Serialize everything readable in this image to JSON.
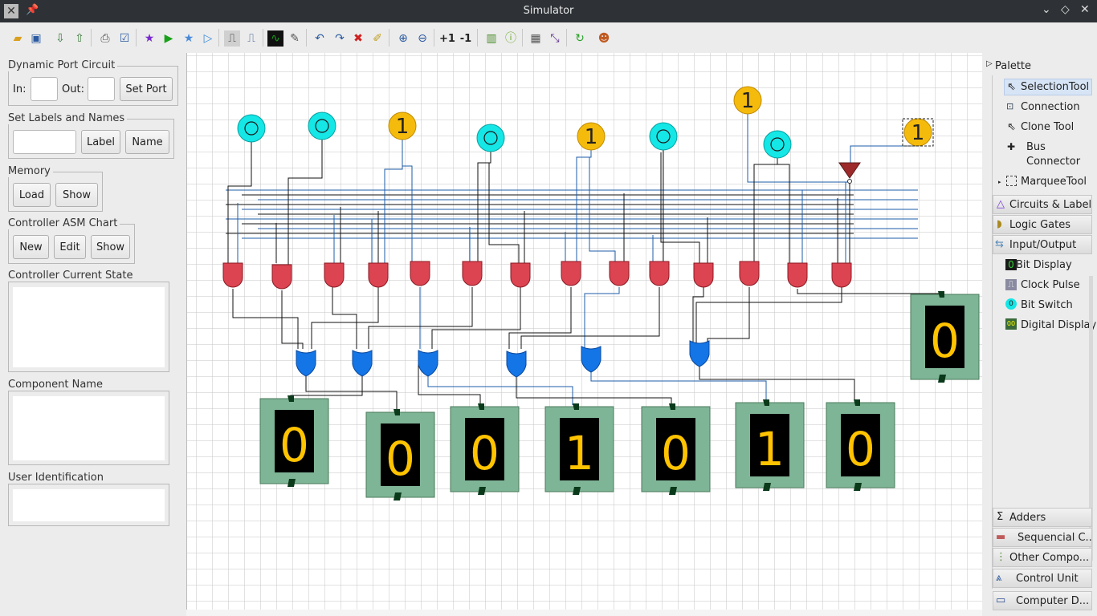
{
  "window": {
    "title": "Simulator"
  },
  "toolbar": {
    "increment_label": "+1",
    "decrement_label": "-1"
  },
  "left": {
    "dynamic_port": {
      "title": "Dynamic Port Circuit",
      "in_label": "In:",
      "out_label": "Out:",
      "set_port": "Set Port",
      "in_value": "",
      "out_value": ""
    },
    "labels": {
      "title": "Set Labels and Names",
      "label_btn": "Label",
      "name_btn": "Name",
      "value": ""
    },
    "memory": {
      "title": "Memory",
      "load": "Load",
      "show": "Show"
    },
    "asm": {
      "title": "Controller ASM Chart",
      "new": "New",
      "edit": "Edit",
      "show": "Show"
    },
    "current_state": {
      "title": "Controller Current State"
    },
    "component_name": {
      "title": "Component Name"
    },
    "user_id": {
      "title": "User Identification"
    }
  },
  "palette": {
    "header": "Palette",
    "tools": [
      "SelectionTool",
      "Connection",
      "Clone Tool",
      "Bus Connector",
      "MarqueeTool"
    ],
    "bus_connector": [
      "Bus",
      "Connector"
    ],
    "categories_top": [
      "Circuits & Label",
      "Logic Gates",
      "Input/Output"
    ],
    "io_items": [
      "Bit Display",
      "Clock Pulse",
      "Bit Switch",
      "Digital Display"
    ],
    "categories_bottom": [
      "Adders",
      "Sequencial C...",
      "Other Compo...",
      "Control Unit",
      "Computer D..."
    ]
  },
  "circuit": {
    "switches": [
      {
        "kind": "o"
      },
      {
        "kind": "o"
      },
      {
        "kind": "1"
      },
      {
        "kind": "o"
      },
      {
        "kind": "1"
      },
      {
        "kind": "o"
      },
      {
        "kind": "1"
      },
      {
        "kind": "o"
      },
      {
        "kind": "1"
      }
    ],
    "switch_on_label": "1",
    "displays": [
      "0",
      "0",
      "0",
      "1",
      "0",
      "1",
      "0",
      "0"
    ]
  },
  "colors": {
    "and_gate": "#dc4452",
    "or_gate": "#1475e6",
    "switch_off": "#15e6e6",
    "switch_on": "#f5bb0c",
    "display_bg": "#7fb597",
    "display_digit": "#ffc300",
    "wire_blue": "#1d5ca8",
    "wire_black": "#111111",
    "buffer": "#9c2a2a"
  }
}
